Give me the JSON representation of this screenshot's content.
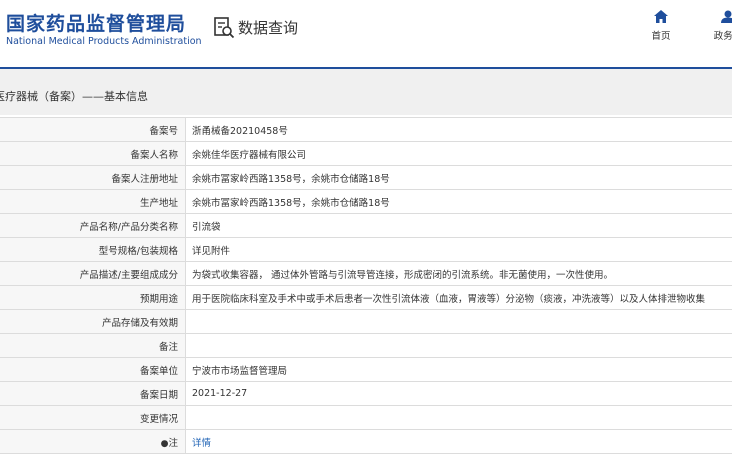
{
  "header": {
    "logo_cn": "国家药品监督管理局",
    "logo_en": "National Medical Products Administration",
    "query_title": "数据查询",
    "nav": [
      {
        "label": "首页",
        "icon": "home-icon"
      },
      {
        "label": "政务服",
        "icon": "user-icon"
      }
    ]
  },
  "breadcrumb": "医疗器械（备案）——基本信息",
  "rows": [
    {
      "label": "备案号",
      "value": "浙甬械备20210458号"
    },
    {
      "label": "备案人名称",
      "value": "余姚佳华医疗器械有限公司"
    },
    {
      "label": "备案人注册地址",
      "value": "余姚市冨家岭西路1358号，余姚市仓储路18号"
    },
    {
      "label": "生产地址",
      "value": "余姚市冨家岭西路1358号，余姚市仓储路18号"
    },
    {
      "label": "产品名称/产品分类名称",
      "value": "引流袋"
    },
    {
      "label": "型号规格/包装规格",
      "value": "详见附件"
    },
    {
      "label": "产品描述/主要组成成分",
      "value": "为袋式收集容器， 通过体外管路与引流导管连接，形成密闭的引流系统。非无菌使用，一次性使用。"
    },
    {
      "label": "预期用途",
      "value": "用于医院临床科室及手术中或手术后患者一次性引流体液（血液，胃液等）分泌物（痰液，冲洗液等）以及人体排泄物收集"
    },
    {
      "label": "产品存储及有效期",
      "value": ""
    },
    {
      "label": "备注",
      "value": ""
    },
    {
      "label": "备案单位",
      "value": "宁波市市场监督管理局"
    },
    {
      "label": "备案日期",
      "value": "2021-12-27"
    },
    {
      "label": "变更情况",
      "value": ""
    }
  ],
  "note_row": {
    "label": "注",
    "link": "详情",
    "icon": "pin-icon"
  },
  "colors": {
    "brand": "#1f4e9c",
    "link": "#1f63b5"
  }
}
